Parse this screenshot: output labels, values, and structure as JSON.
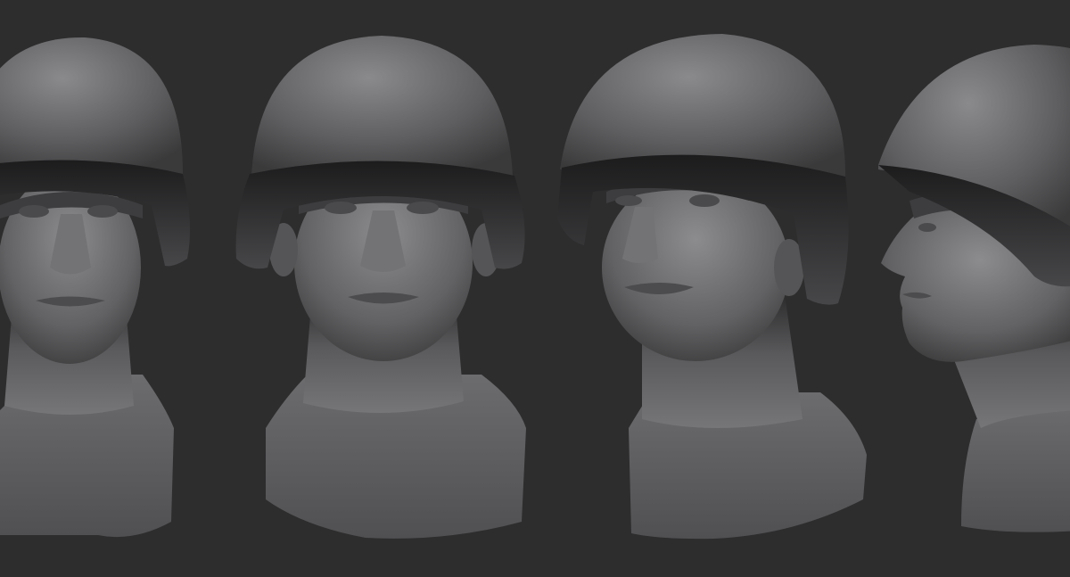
{
  "scene": {
    "background_color": "#2d2d2e",
    "material_color": "#6e6e70",
    "subject": "soldier-bust-with-helmet",
    "views": [
      {
        "id": "front-left",
        "angle": "front"
      },
      {
        "id": "front-center",
        "angle": "front"
      },
      {
        "id": "three-quarter",
        "angle": "three-quarter-left"
      },
      {
        "id": "profile",
        "angle": "profile-left"
      }
    ]
  }
}
